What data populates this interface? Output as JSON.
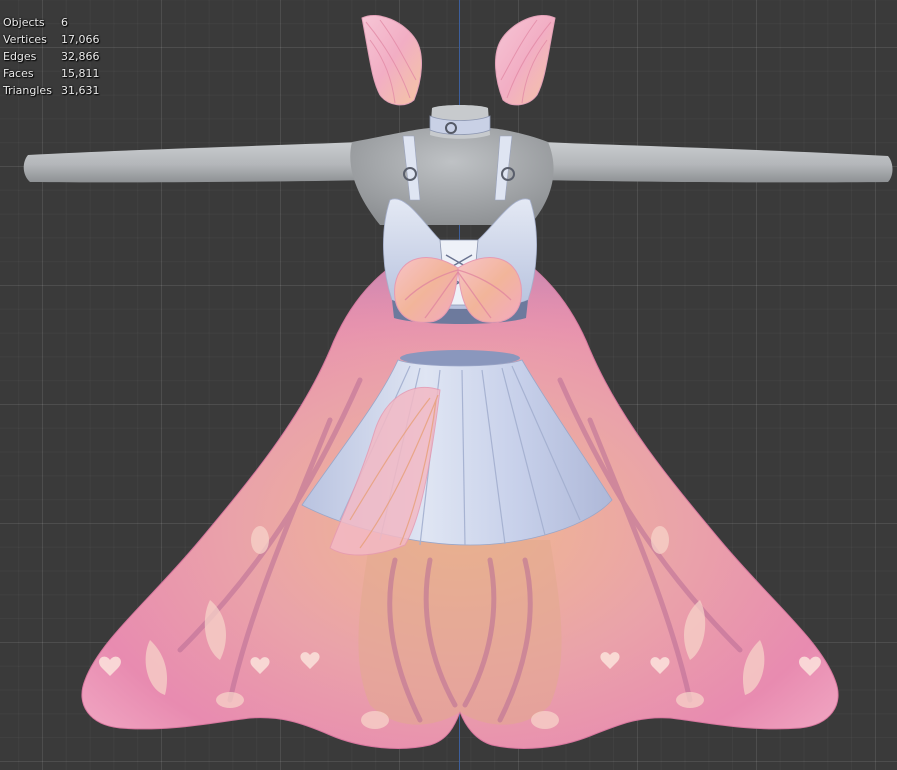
{
  "viewport": {
    "name": "3D Viewport",
    "grid_visible": true,
    "colors": {
      "background": "#3a3a3a",
      "grid_line": "#4a4a4a",
      "z_axis": "#3d5f9c"
    }
  },
  "statistics": [
    {
      "label": "Objects",
      "value": "6"
    },
    {
      "label": "Vertices",
      "value": "17,066"
    },
    {
      "label": "Edges",
      "value": "32,866"
    },
    {
      "label": "Faces",
      "value": "15,811"
    },
    {
      "label": "Triangles",
      "value": "31,631"
    }
  ],
  "model": {
    "colors": {
      "body": "#b9bcbf",
      "top": "#d4dced",
      "skirt": "#cbd3ea",
      "wing_pink": "#e87fa6",
      "wing_light": "#f3bccd",
      "wing_orange": "#f2b27a",
      "wing_vein": "#b56f95"
    }
  }
}
